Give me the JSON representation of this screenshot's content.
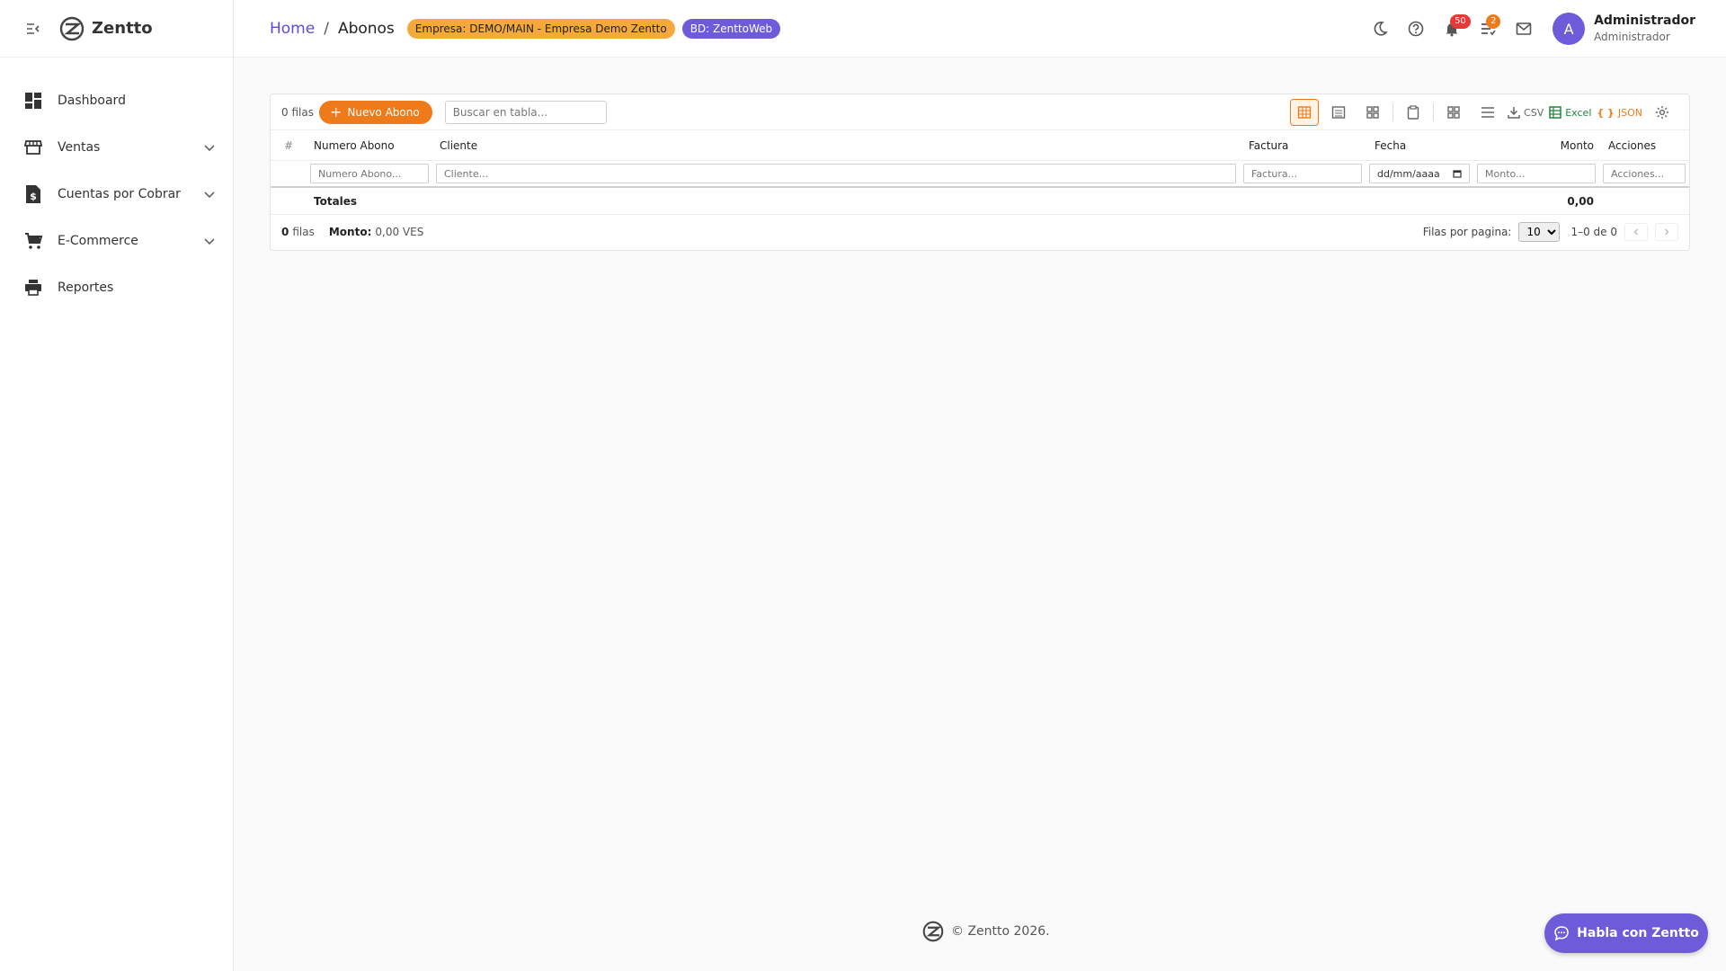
{
  "brand": {
    "name": "Zentto"
  },
  "sidebar": {
    "items": [
      {
        "label": "Dashboard",
        "icon": "dashboard-icon"
      },
      {
        "label": "Ventas",
        "icon": "store-icon"
      },
      {
        "label": "Cuentas por Cobrar",
        "icon": "invoice-dollar-icon"
      },
      {
        "label": "E-Commerce",
        "icon": "cart-icon"
      },
      {
        "label": "Reportes",
        "icon": "printer-icon"
      }
    ]
  },
  "header": {
    "breadcrumb_home": "Home",
    "breadcrumb_sep": "/",
    "breadcrumb_current": "Abonos",
    "chip_empresa": "Empresa: DEMO/MAIN - Empresa Demo Zentto",
    "chip_bd": "BD: ZenttoWeb",
    "notifications_count": "50",
    "tasks_count": "2",
    "avatar_letter": "A",
    "user_name": "Administrador",
    "user_role": "Administrador"
  },
  "table": {
    "rows_label": "0 filas",
    "new_button": "Nuevo Abono",
    "search_placeholder": "Buscar en tabla...",
    "export_csv": "CSV",
    "export_excel": "Excel",
    "export_json": "JSON",
    "columns": [
      "#",
      "Numero Abono",
      "Cliente",
      "Factura",
      "Fecha",
      "Monto",
      "Acciones"
    ],
    "filters": {
      "numero": "Numero Abono...",
      "cliente": "Cliente...",
      "factura": "Factura...",
      "fecha": "dd/mm/aaaa",
      "monto": "Monto...",
      "acciones": "Acciones..."
    },
    "totals_label": "Totales",
    "totals_monto": "0,00",
    "footer_count": "0",
    "footer_count_suffix": "filas",
    "footer_monto_label": "Monto:",
    "footer_monto_value": "0,00 VES",
    "rows_per_page_label": "Filas por pagina:",
    "rows_per_page_value": "10",
    "page_range": "1–0 de 0"
  },
  "footer": {
    "copyright": "© Zentto 2026."
  },
  "chat": {
    "label": "Habla con Zentto"
  },
  "colors": {
    "accent": "#ef7a1a",
    "brand": "#6d5bd9",
    "link": "#5b4ed6"
  }
}
